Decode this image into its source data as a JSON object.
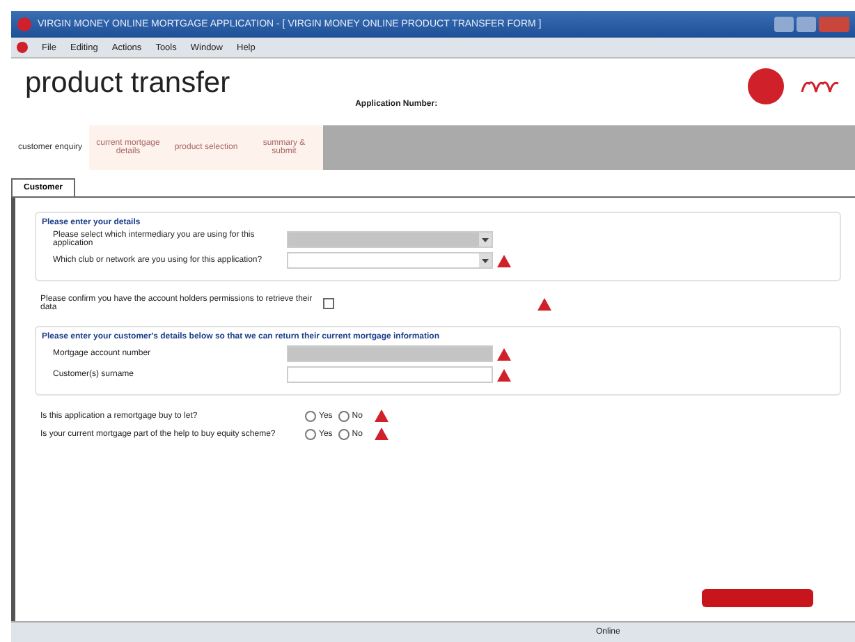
{
  "window": {
    "title": "VIRGIN MONEY ONLINE MORTGAGE APPLICATION - [ VIRGIN MONEY ONLINE PRODUCT TRANSFER FORM ]"
  },
  "menu": [
    "File",
    "Editing",
    "Actions",
    "Tools",
    "Window",
    "Help"
  ],
  "header": {
    "title": "product transfer",
    "application_number_label": "Application Number:"
  },
  "steps": [
    {
      "label": "customer enquiry",
      "selected": true
    },
    {
      "label": "current mortgage details",
      "selected": false
    },
    {
      "label": "product selection",
      "selected": false
    },
    {
      "label": "summary & submit",
      "selected": false
    }
  ],
  "tabs": [
    {
      "label": "Customer",
      "selected": true
    }
  ],
  "sections": [
    {
      "kind": "group",
      "heading": "Please enter your details",
      "rows": [
        {
          "kind": "select",
          "label": "Please select which intermediary you are using for this application",
          "disabled": true,
          "required": false
        },
        {
          "kind": "select",
          "label": "Which club or network are you using for this application?",
          "disabled": false,
          "required": true
        }
      ]
    },
    {
      "kind": "plain",
      "rows": [
        {
          "kind": "checkbox",
          "label": "Please confirm you have the account holders permissions to retrieve their data",
          "checked": false,
          "required": true
        }
      ]
    },
    {
      "kind": "group",
      "heading": "Please enter your customer's details below so that we can return their current mortgage information",
      "rows": [
        {
          "kind": "text",
          "label": "Mortgage account number",
          "disabled": true,
          "required": true
        },
        {
          "kind": "text",
          "label": "Customer(s) surname",
          "disabled": false,
          "required": true
        }
      ]
    },
    {
      "kind": "plain",
      "rows": [
        {
          "kind": "radio",
          "label": "Is this application a remortgage buy to let?",
          "options": [
            {
              "label": "Yes",
              "selected": false
            },
            {
              "label": "No",
              "selected": false
            }
          ],
          "required": true
        },
        {
          "kind": "radio",
          "label": "Is your current mortgage part of the help to buy equity scheme?",
          "options": [
            {
              "label": "Yes",
              "selected": false
            },
            {
              "label": "No",
              "selected": false
            }
          ],
          "required": true
        }
      ]
    }
  ],
  "status_bar": {
    "items": [
      "Online"
    ]
  }
}
